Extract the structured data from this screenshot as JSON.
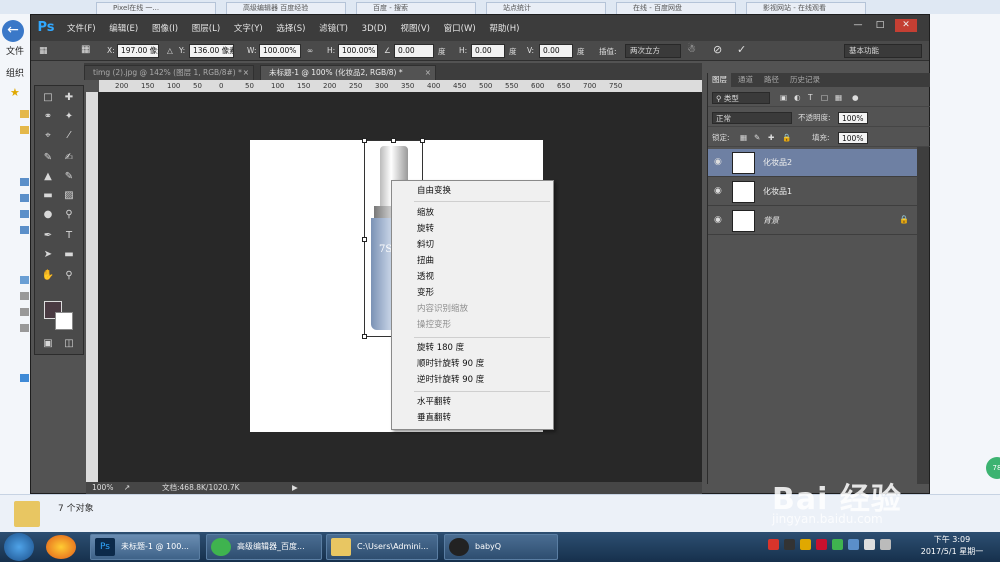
{
  "bg_tabs": [
    "Pixel在线 一...",
    "高级编辑器 百度经验",
    "百度 - 搜索",
    "站点统计",
    "在线 - 百度网盘",
    "影视网站 - 在线观看"
  ],
  "explorer": {
    "item_count": "7 个对象",
    "left_labels": [
      "文件",
      "组织"
    ]
  },
  "ps": {
    "logo": "Ps",
    "menu": [
      "文件(F)",
      "编辑(E)",
      "图像(I)",
      "图层(L)",
      "文字(Y)",
      "选择(S)",
      "滤镜(T)",
      "3D(D)",
      "视图(V)",
      "窗口(W)",
      "帮助(H)"
    ],
    "options": {
      "x_label": "X:",
      "x_value": "197.00 像素",
      "y_label": "Y:",
      "y_value": "136.00 像素",
      "w_label": "W:",
      "w_value": "100.00%",
      "h_label": "H:",
      "h_value": "100.00%",
      "angle_value": "0.00",
      "angle_unit": "度",
      "hskew_label": "H:",
      "hskew_value": "0.00",
      "hskew_unit": "度",
      "vskew_label": "V:",
      "vskew_value": "0.00",
      "vskew_unit": "度",
      "interp_label": "插值:",
      "interp_value": "两次立方",
      "workspace": "基本功能"
    },
    "doc_tabs": [
      {
        "label": "timg (2).jpg @ 142% (图层 1, RGB/8#) *",
        "active": false
      },
      {
        "label": "未标题-1 @ 100% (化妆品2, RGB/8) *",
        "active": true
      }
    ],
    "ruler_ticks": [
      "200",
      "150",
      "100",
      "50",
      "0",
      "50",
      "100",
      "150",
      "200",
      "250",
      "300",
      "350",
      "400",
      "450",
      "500",
      "550",
      "600",
      "650",
      "700",
      "750"
    ],
    "bottle_brand": "7S ac",
    "status": {
      "zoom": "100%",
      "doc": "文档:468.8K/1020.7K"
    },
    "context_menu": {
      "group1": [
        "自由变换"
      ],
      "group2": [
        "缩放",
        "旋转",
        "斜切",
        "扭曲",
        "透视",
        "变形"
      ],
      "group2_disabled": [
        "内容识别缩放",
        "操控变形"
      ],
      "group3": [
        "旋转 180 度",
        "顺时针旋转 90 度",
        "逆时针旋转 90 度"
      ],
      "group4": [
        "水平翻转",
        "垂直翻转"
      ]
    },
    "panel": {
      "tabs": [
        "图层",
        "通道",
        "路径",
        "历史记录"
      ],
      "kind_filter": "类型",
      "blend_mode": "正常",
      "opacity_label": "不透明度:",
      "opacity_value": "100%",
      "lock_label": "锁定:",
      "fill_label": "填充:",
      "fill_value": "100%",
      "layers": [
        {
          "name": "化妆品2",
          "selected": true
        },
        {
          "name": "化妆品1",
          "selected": false
        },
        {
          "name": "背景",
          "selected": false
        }
      ]
    }
  },
  "taskbar": {
    "items": [
      {
        "label": "未标题-1 @ 100...",
        "active": true
      },
      {
        "label": "高级编辑器_百度...",
        "active": false
      },
      {
        "label": "C:\\Users\\Admini...",
        "active": false
      },
      {
        "label": "babyQ",
        "active": false
      }
    ],
    "clock_time": "下午 3:09",
    "clock_date": "2017/5/1 星期一"
  },
  "watermark": {
    "text": "Bai 经验",
    "url": "jingyan.baidu.com"
  },
  "badge": "78",
  "colors": {
    "ps_bg": "#535353",
    "canvas_bg": "#282828",
    "selected_layer": "#6e80a3",
    "ps_accent": "#31a8ff"
  }
}
